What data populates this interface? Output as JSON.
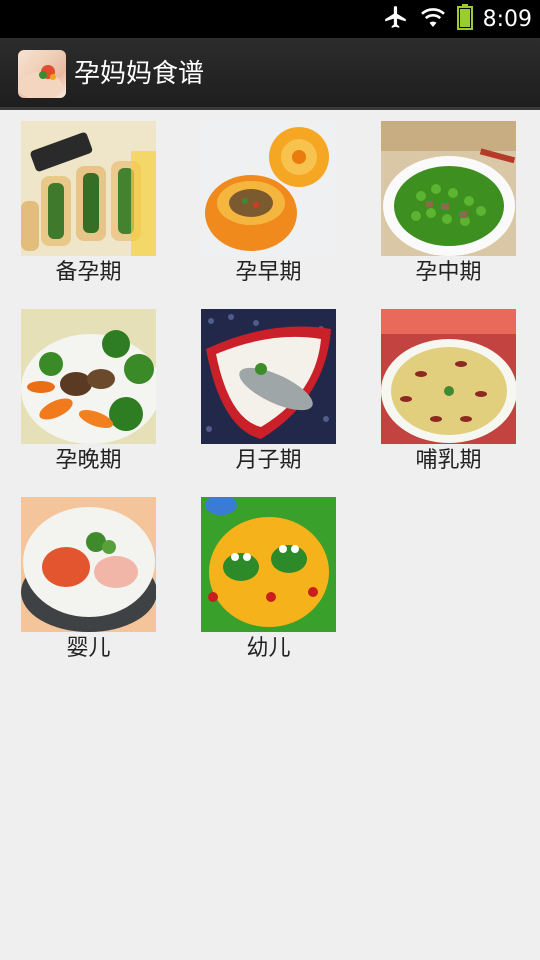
{
  "status_bar": {
    "time": "8:09",
    "icons": [
      "airplane-mode-icon",
      "wifi-icon",
      "battery-icon"
    ]
  },
  "app_bar": {
    "title": "孕妈妈食谱",
    "icon": "app-logo-icon"
  },
  "categories": [
    {
      "label": "备孕期",
      "image": "rolled-tofu-skin-spinach-photo"
    },
    {
      "label": "孕早期",
      "image": "carved-pumpkin-bowl-photo"
    },
    {
      "label": "孕中期",
      "image": "edamame-stir-fry-photo"
    },
    {
      "label": "孕晚期",
      "image": "broccoli-carrot-mushroom-photo"
    },
    {
      "label": "月子期",
      "image": "fish-soup-photo"
    },
    {
      "label": "哺乳期",
      "image": "egg-pancake-photo"
    },
    {
      "label": "婴儿",
      "image": "baby-congee-photo"
    },
    {
      "label": "幼儿",
      "image": "frog-shaped-food-photo"
    }
  ]
}
